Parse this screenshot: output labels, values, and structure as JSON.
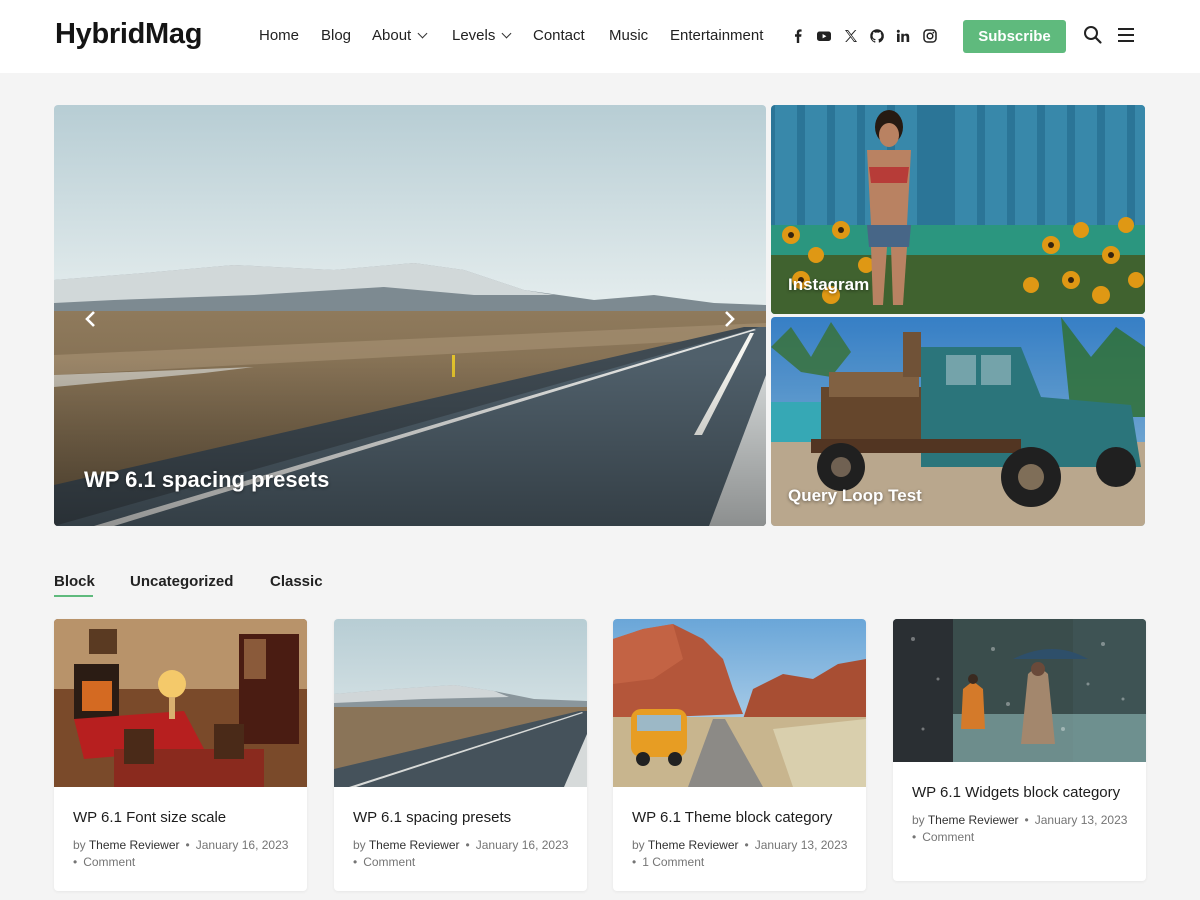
{
  "site": {
    "title": "HybridMag"
  },
  "nav": {
    "items": [
      {
        "label": "Home"
      },
      {
        "label": "Blog"
      },
      {
        "label": "About"
      },
      {
        "label": "Levels"
      },
      {
        "label": "Contact"
      },
      {
        "label": "Music"
      },
      {
        "label": "Entertainment"
      }
    ]
  },
  "social": [
    "facebook-icon",
    "youtube-icon",
    "x-icon",
    "github-icon",
    "linkedin-icon",
    "instagram-icon"
  ],
  "header": {
    "subscribe_label": "Subscribe"
  },
  "colors": {
    "accent": "#5fba7d",
    "background": "#f4f4f4",
    "header": "#ffffff"
  },
  "hero": {
    "main": {
      "title": "WP 6.1 spacing presets"
    },
    "side": [
      {
        "title": "Instagram"
      },
      {
        "title": "Query Loop Test"
      }
    ]
  },
  "tabs": [
    {
      "label": "Block",
      "active": true
    },
    {
      "label": "Uncategorized",
      "active": false
    },
    {
      "label": "Classic",
      "active": false
    }
  ],
  "posts": [
    {
      "title": "WP 6.1 Font size scale",
      "by": "by",
      "author": "Theme Reviewer",
      "date": "January 16, 2023",
      "comments": "Comment"
    },
    {
      "title": "WP 6.1 spacing presets",
      "by": "by",
      "author": "Theme Reviewer",
      "date": "January 16, 2023",
      "comments": "Comment"
    },
    {
      "title": "WP 6.1 Theme block category",
      "by": "by",
      "author": "Theme Reviewer",
      "date": "January 13, 2023",
      "comments": "1 Comment"
    },
    {
      "title": "WP 6.1 Widgets block category",
      "by": "by",
      "author": "Theme Reviewer",
      "date": "January 13, 2023",
      "comments": "Comment"
    }
  ]
}
